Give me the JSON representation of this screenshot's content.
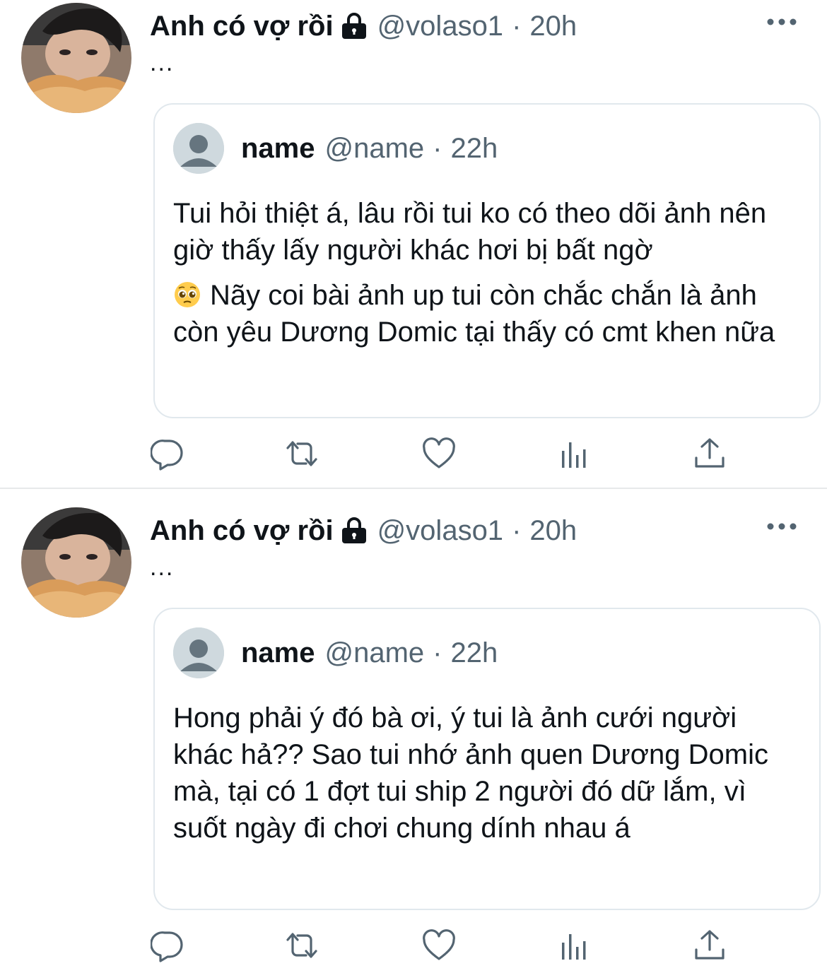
{
  "tweets": [
    {
      "author": {
        "display_name": "Anh có vợ rồi",
        "handle": "@volaso1",
        "time": "20h",
        "ellipsis": "..."
      },
      "quote": {
        "name": "name",
        "handle": "@name",
        "time": "22h",
        "paragraphs": [
          "Tui hỏi thiệt á, lâu rồi tui ko có theo dõi ảnh nên giờ thấy lấy người khác hơi bị bất ngờ",
          "Nãy coi bài ảnh up tui còn chắc chắn là ảnh còn yêu Dương Domic tại thấy có cmt khen nữa"
        ],
        "emoji": "pleading-face-icon"
      }
    },
    {
      "author": {
        "display_name": "Anh có vợ rồi",
        "handle": "@volaso1",
        "time": "20h",
        "ellipsis": "..."
      },
      "quote": {
        "name": "name",
        "handle": "@name",
        "time": "22h",
        "paragraphs": [
          "Hong phải ý đó bà ơi, ý tui là ảnh cưới người khác hả?? Sao tui nhớ ảnh quen Dương Domic mà, tại có 1 đợt tui ship 2 người đó dữ lắm, vì suốt ngày đi chơi chung dính nhau á"
        ]
      }
    }
  ],
  "separator": "·",
  "actions": [
    "reply-icon",
    "retweet-icon",
    "like-icon",
    "analytics-icon",
    "share-icon"
  ],
  "colors": {
    "text": "#0f1419",
    "secondary": "#536471",
    "border": "#e1e8ed",
    "icon": "#536471"
  }
}
